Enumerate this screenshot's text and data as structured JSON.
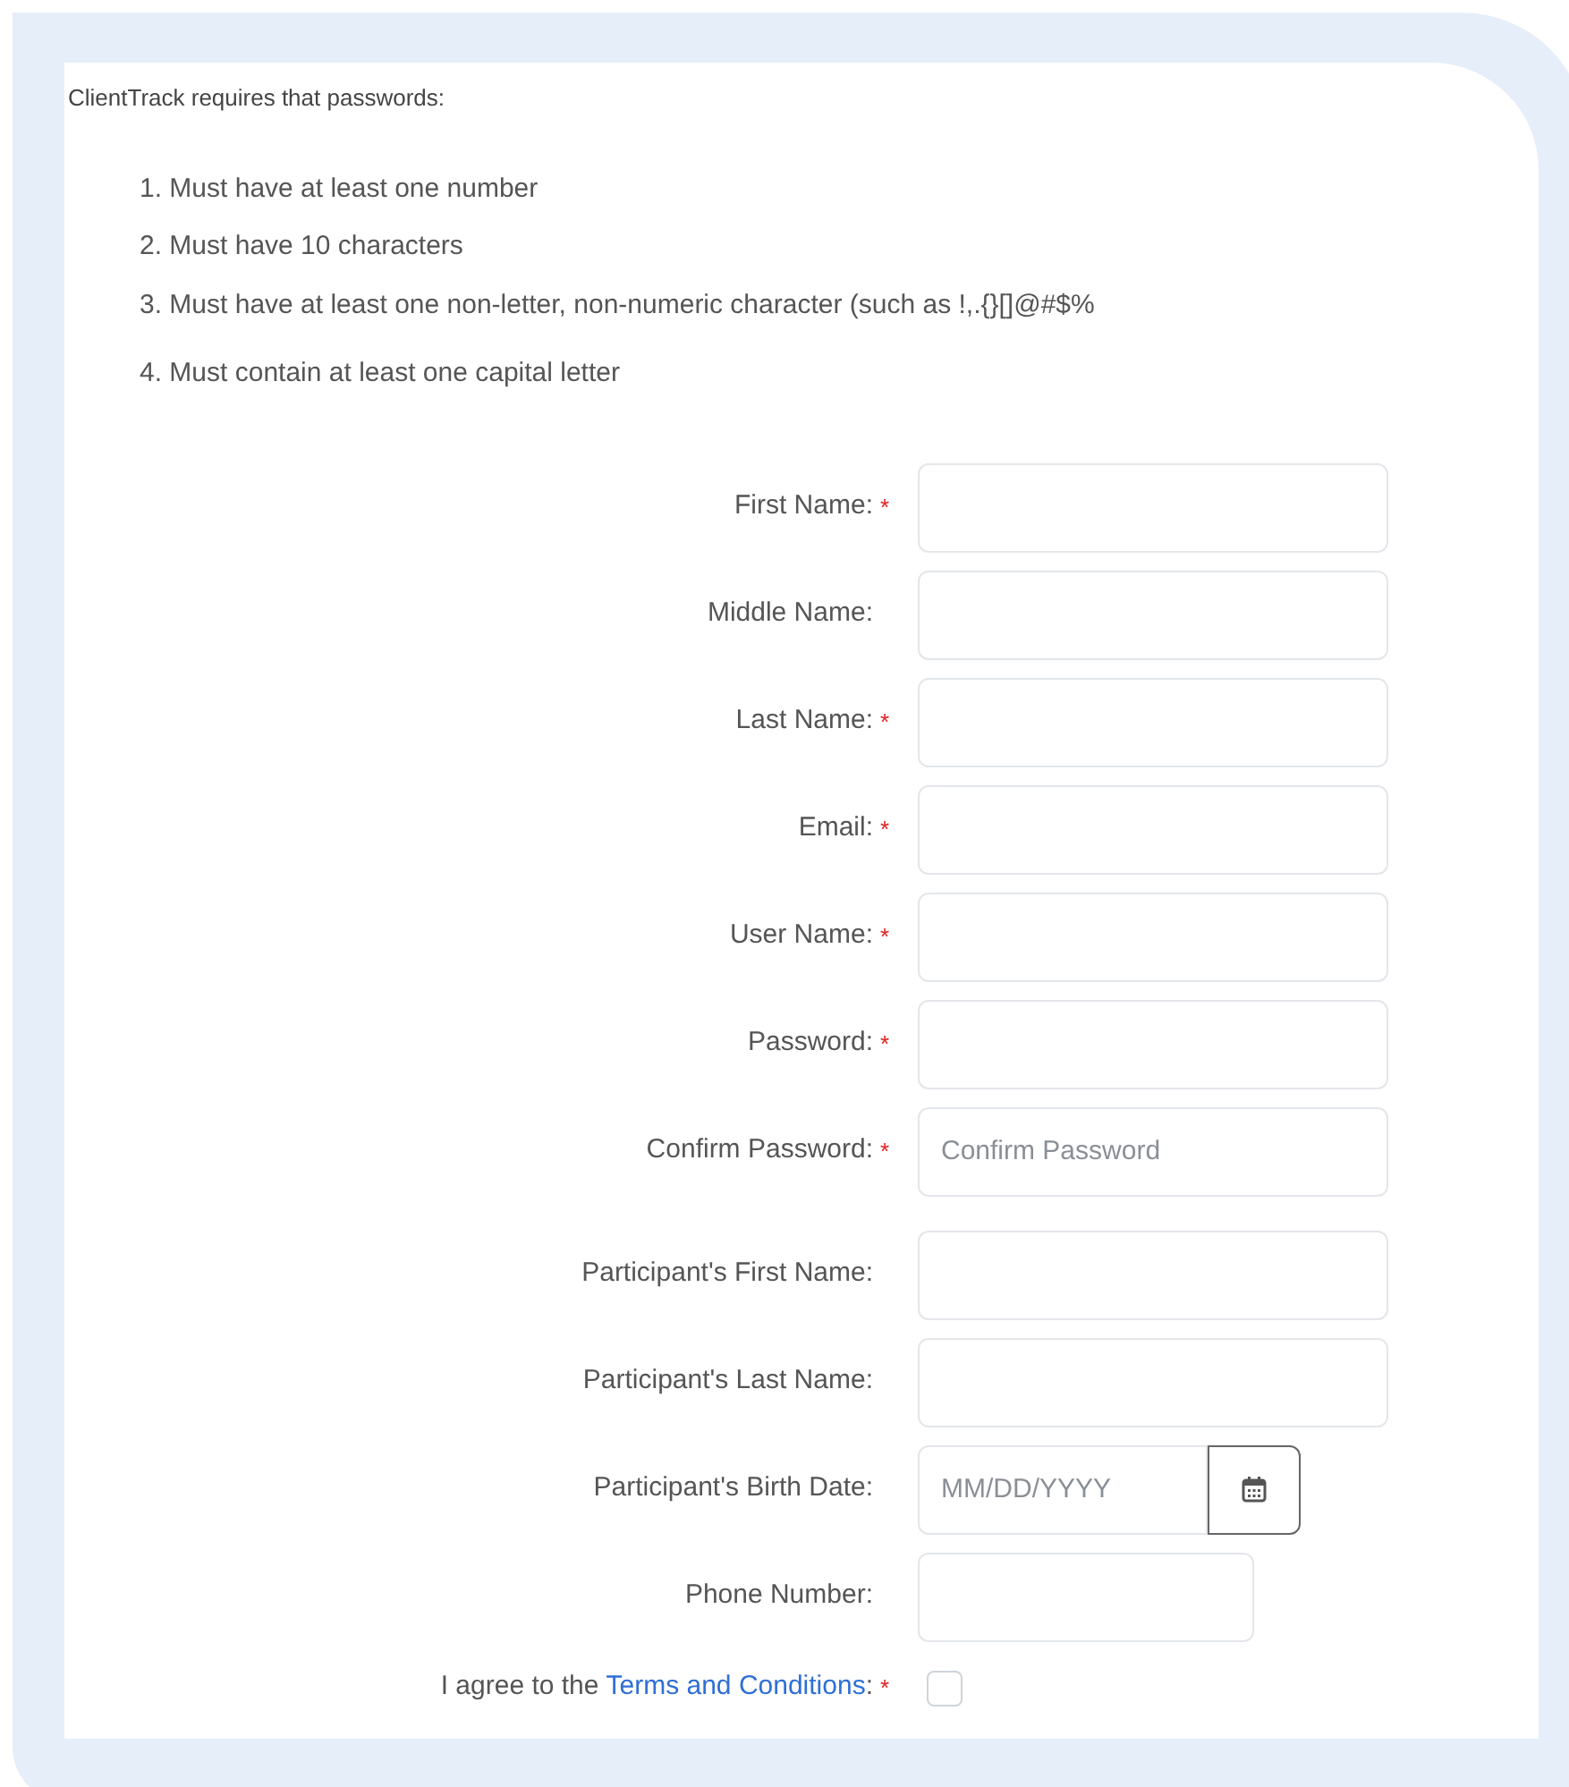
{
  "intro": "ClientTrack requires that passwords:",
  "rules": [
    "1. Must have at least one number",
    "2. Must have 10 characters",
    "3. Must have at least one non-letter, non-numeric character (such as !,.{}[]@#$%",
    "4. Must contain at least one capital letter"
  ],
  "fields": [
    {
      "label": "First Name:",
      "required_mark": "*",
      "kind": "text"
    },
    {
      "label": "Middle Name:",
      "kind": "text"
    },
    {
      "label": "Last Name:",
      "required_mark": "*",
      "kind": "text"
    },
    {
      "label": "Email:",
      "required_mark": "*",
      "kind": "text"
    },
    {
      "label": "User Name:",
      "required_mark": "*",
      "kind": "text"
    },
    {
      "label": "Password:",
      "required_mark": "*",
      "kind": "text"
    },
    {
      "label": "Confirm Password:",
      "required_mark": "*",
      "kind": "text",
      "placeholder": "Confirm Password"
    },
    {
      "label": "Participant's First Name:",
      "kind": "text"
    },
    {
      "label": "Participant's Last Name:",
      "kind": "text"
    },
    {
      "label": "Participant's Birth Date:",
      "kind": "date",
      "placeholder": "MM/DD/YYYY"
    },
    {
      "label": "Phone Number:",
      "kind": "short"
    }
  ],
  "terms": {
    "prefix": "I agree to the",
    "link": "Terms and Conditions",
    "suffix": ":",
    "required_mark": "*",
    "checked": false
  }
}
